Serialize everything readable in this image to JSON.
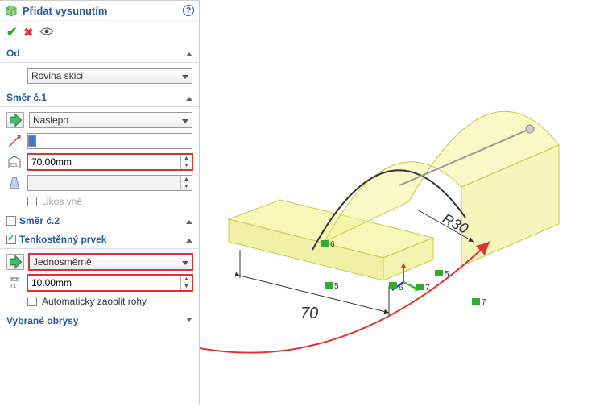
{
  "title": "Přidat vysunutím",
  "sections": {
    "od": {
      "label": "Od",
      "combo": "Rovina skici"
    },
    "smer1": {
      "label": "Směr č.1",
      "end_condition": "Naslepo",
      "depth": "70.00mm",
      "draft": "",
      "draft_out_label": "Úkos vně"
    },
    "smer2": {
      "label": "Směr č.2"
    },
    "thin": {
      "label": "Tenkostěnný prvek",
      "type": "Jednosměrně",
      "thickness": "10.00mm",
      "auto_round_label": "Automaticky zaoblit rohy"
    },
    "contours": {
      "label": "Vybrané obrysy"
    }
  },
  "annotations": {
    "dim_width": "70",
    "dim_radius": "R30",
    "rel1": "6",
    "rel2": "5",
    "rel3": "6",
    "rel4": "7",
    "rel5": "5",
    "rel6": "7"
  }
}
